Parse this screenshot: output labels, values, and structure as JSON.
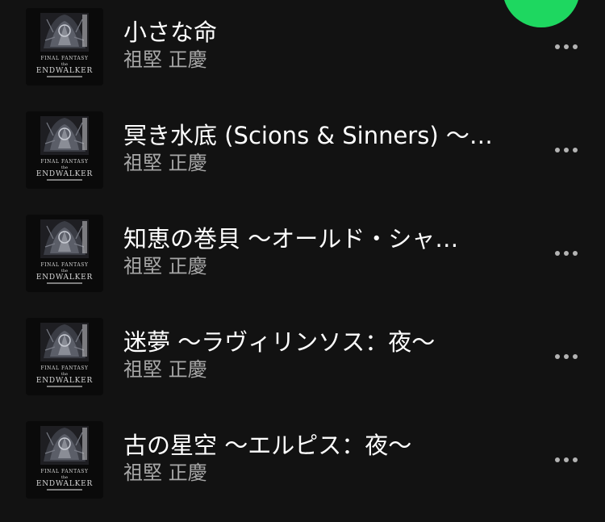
{
  "colors": {
    "background": "#121212",
    "title": "#ffffff",
    "subtitle": "#a7a7a7",
    "accent": "#1ed760"
  },
  "cover_art": {
    "line1": "FINAL FANTASY",
    "line2": "the",
    "line3": "ENDWALKER"
  },
  "tracks": [
    {
      "title": "小さな命",
      "artist": "祖堅 正慶",
      "more_icon": "more-horizontal-icon"
    },
    {
      "title": "冥き水底 (Scions & Sinners) ～…",
      "artist": "祖堅 正慶",
      "more_icon": "more-horizontal-icon"
    },
    {
      "title": "知恵の巻貝 ～オールド・シャ…",
      "artist": "祖堅 正慶",
      "more_icon": "more-horizontal-icon"
    },
    {
      "title": "迷夢 ～ラヴィリンソス：夜～",
      "artist": "祖堅 正慶",
      "more_icon": "more-horizontal-icon"
    },
    {
      "title": "古の星空 ～エルピス：夜～",
      "artist": "祖堅 正慶",
      "more_icon": "more-horizontal-icon"
    }
  ]
}
